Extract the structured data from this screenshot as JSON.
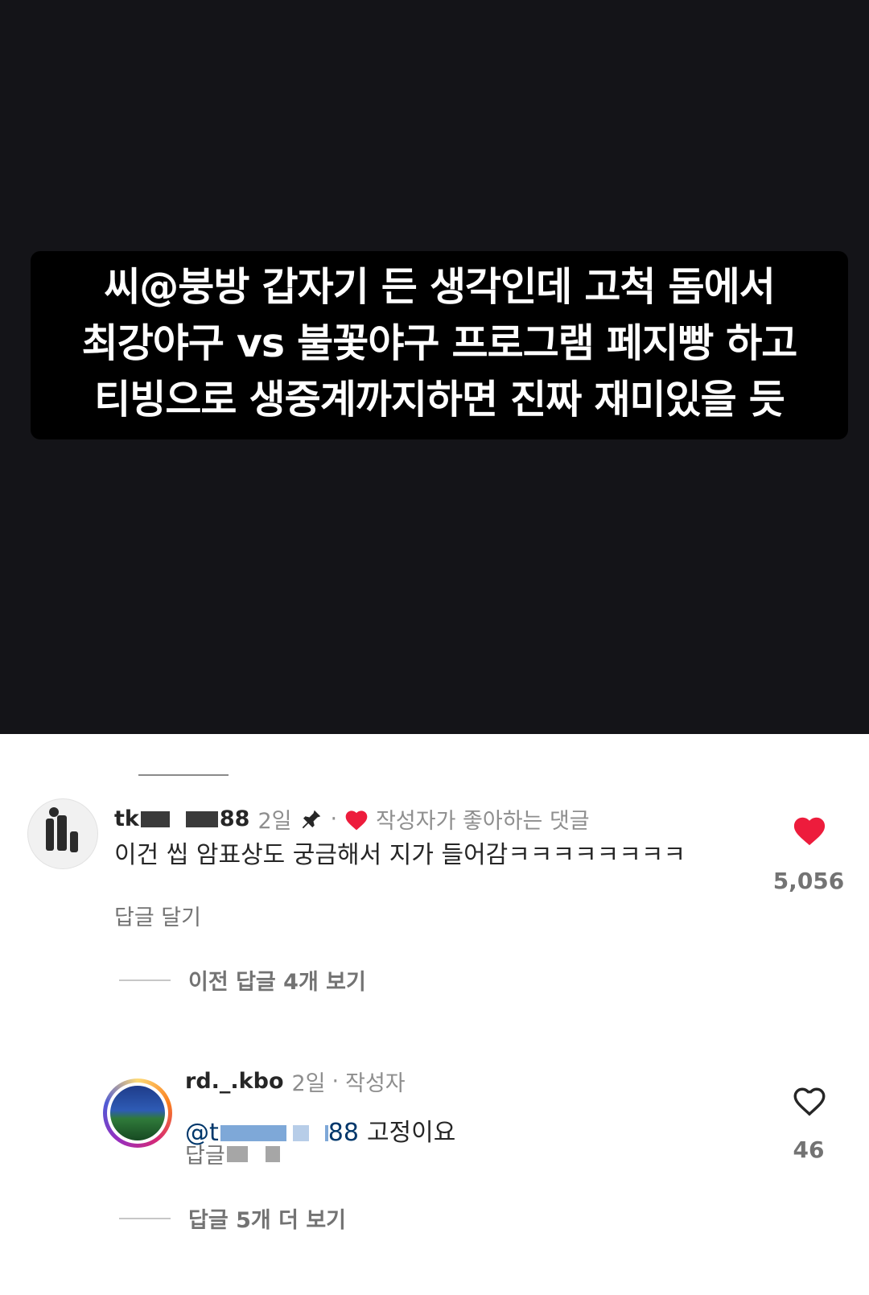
{
  "story": {
    "caption_lines": [
      "씨@붕방 갑자기 든 생각인데 고척 돔에서",
      "최강야구 vs 불꽃야구 프로그램 페지빵 하고",
      "티빙으로 생중계까지하면 진짜 재미있을 듯"
    ]
  },
  "comments": {
    "top": {
      "username_prefix": "tk",
      "username_suffix": "88",
      "time": "2일",
      "separator": "·",
      "liked_by_author": "작성자가 좋아하는 댓글",
      "text": "이건 씹 암표상도 궁금해서 지가 들어감ㅋㅋㅋㅋㅋㅋㅋㅋ",
      "reply_label": "답글 달기",
      "like_count": "5,056",
      "heart_color": "#ed1c3c"
    },
    "view_previous": "이전 답글 4개 보기",
    "reply": {
      "username": "rd._.kbo",
      "time": "2일",
      "separator": "·",
      "author_label": "작성자",
      "mention_prefix": "@t",
      "mention_suffix": "88",
      "text": "고정이요",
      "reply_label": "답글",
      "like_count": "46"
    },
    "view_more": "답글 5개 더 보기"
  },
  "icons": [
    "pin-icon",
    "heart-filled-icon",
    "heart-outline-icon"
  ]
}
